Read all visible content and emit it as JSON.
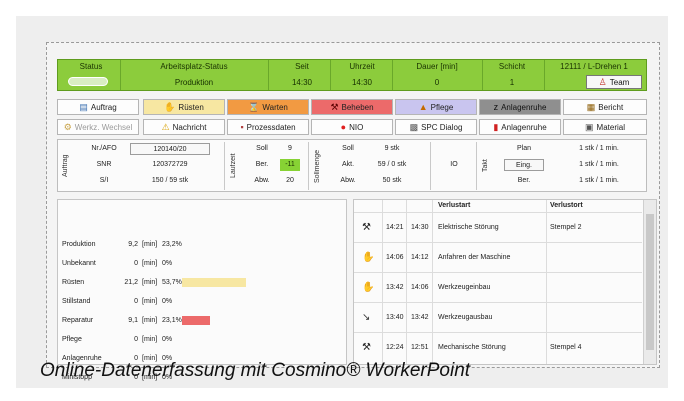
{
  "caption": "Online-Datenerfassung mit Cosmino® WorkerPoint",
  "status": {
    "headers": [
      "Status",
      "Arbeitsplatz-Status",
      "Seit",
      "Uhrzeit",
      "Dauer [min]",
      "Schicht",
      "12111 / L-Drehen 1"
    ],
    "values": [
      "Produktion",
      "14:30",
      "14:30",
      "0",
      "1"
    ],
    "team_label": "Team"
  },
  "buttons_row1": [
    "Auftrag",
    "Rüsten",
    "Warten",
    "Beheben",
    "Pflege",
    "Anlagenruhe",
    "Bericht"
  ],
  "buttons_row2": [
    "Werkz. Wechsel",
    "Nachricht",
    "Prozessdaten",
    "NIO",
    "SPC Dialog",
    "Anlagenruhe",
    "Material"
  ],
  "colors": {
    "status_green": "#8ccc3c",
    "ruesten": "#f7e7a2",
    "warten": "#f29a42",
    "beheben": "#ec6a6a",
    "pflege": "#c9c5ef",
    "anlagenruhe": "#8f8f8f",
    "bar_ruesten": "#f7e7a2",
    "bar_reparatur": "#ec6a6a"
  },
  "info": {
    "auftrag_label": "Auftrag",
    "fields": [
      {
        "label": "Nr./AFO",
        "value": "120140/20"
      },
      {
        "label": "SNR",
        "value": "120372729"
      },
      {
        "label": "S/I",
        "value": "150 / 59 stk"
      }
    ],
    "laufzeit_label": "Laufzeit",
    "laufzeit": [
      {
        "label": "Soll",
        "value": "9"
      },
      {
        "label": "Ber.",
        "value": "-11"
      },
      {
        "label": "Abw.",
        "value": "20"
      }
    ],
    "sollmenge_label": "Sollmenge",
    "sollmenge": [
      {
        "label": "Soll",
        "value": "9 stk"
      },
      {
        "label": "Akt.",
        "value": "59 / 0 stk"
      },
      {
        "label": "Abw.",
        "value": "50 stk"
      }
    ],
    "io_label": "IO",
    "takt_label": "Takt",
    "takt": [
      {
        "label": "Plan",
        "value": "1 stk / 1 min."
      },
      {
        "label": "Eing.",
        "value": "1 stk / 1 min."
      },
      {
        "label": "Ber.",
        "value": "1 stk / 1 min."
      }
    ]
  },
  "stats": [
    {
      "label": "Produktion",
      "minutes": "9,2",
      "unit": "[min]",
      "percent": "23,2%",
      "fraction": 0
    },
    {
      "label": "Unbekannt",
      "minutes": "0",
      "unit": "[min]",
      "percent": "0%",
      "fraction": 0
    },
    {
      "label": "Rüsten",
      "minutes": "21,2",
      "unit": "[min]",
      "percent": "53,7%",
      "fraction": 0.537
    },
    {
      "label": "Stillstand",
      "minutes": "0",
      "unit": "[min]",
      "percent": "0%",
      "fraction": 0
    },
    {
      "label": "Reparatur",
      "minutes": "9,1",
      "unit": "[min]",
      "percent": "23,1%",
      "fraction": 0.231
    },
    {
      "label": "Pflege",
      "minutes": "0",
      "unit": "[min]",
      "percent": "0%",
      "fraction": 0
    },
    {
      "label": "Anlagenruhe",
      "minutes": "0",
      "unit": "[min]",
      "percent": "0%",
      "fraction": 0
    },
    {
      "label": "Ministopp",
      "minutes": "0",
      "unit": "[min]",
      "percent": "0%",
      "fraction": 0
    }
  ],
  "losses": {
    "headers": [
      "Verlustart",
      "Verlustort"
    ],
    "rows": [
      {
        "icon": "wrench-icon",
        "start": "14:21",
        "end": "14:30",
        "type": "Elektrische Störung",
        "location": "Stempel 2"
      },
      {
        "icon": "hand-icon",
        "start": "14:06",
        "end": "14:12",
        "type": "Anfahren der Maschine",
        "location": ""
      },
      {
        "icon": "hand-icon",
        "start": "13:42",
        "end": "14:06",
        "type": "Werkzeugeinbau",
        "location": ""
      },
      {
        "icon": "cursor-icon",
        "start": "13:40",
        "end": "13:42",
        "type": "Werkzeugausbau",
        "location": ""
      },
      {
        "icon": "wrench-icon",
        "start": "12:24",
        "end": "12:51",
        "type": "Mechanische Störung",
        "location": "Stempel 4"
      }
    ]
  }
}
